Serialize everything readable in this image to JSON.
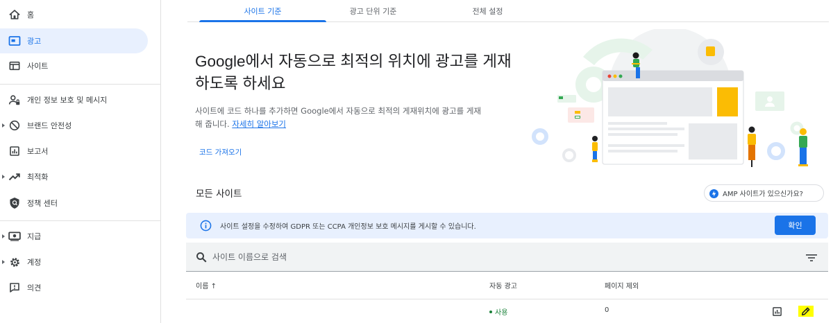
{
  "sidebar": {
    "items": [
      {
        "label": "홈",
        "icon": "home-icon"
      },
      {
        "label": "광고",
        "icon": "ad-icon",
        "active": true
      },
      {
        "label": "사이트",
        "icon": "sites-icon"
      },
      {
        "label": "개인 정보 보호 및 메시지",
        "icon": "privacy-icon"
      },
      {
        "label": "브랜드 안전성",
        "icon": "block-icon"
      },
      {
        "label": "보고서",
        "icon": "report-icon"
      },
      {
        "label": "최적화",
        "icon": "trending-icon"
      },
      {
        "label": "정책 센터",
        "icon": "policy-icon"
      },
      {
        "label": "지급",
        "icon": "payments-icon"
      },
      {
        "label": "계정",
        "icon": "settings-icon"
      },
      {
        "label": "의견",
        "icon": "feedback-icon"
      }
    ]
  },
  "tabs": [
    {
      "label": "사이트 기준",
      "active": true
    },
    {
      "label": "광고 단위 기준"
    },
    {
      "label": "전체 설정"
    }
  ],
  "hero": {
    "title_line1": "Google에서 자동으로 최적의 위치에 광고를 게재",
    "title_line2": "하도록 하세요",
    "desc_line1": "사이트에 코드 하나를 추가하면 Google에서 자동으로 최적의 게재위치에 광고를 게재",
    "desc_line2": "해 줍니다.",
    "learn_more": "자세히 알아보기",
    "import_code": "코드 가져오기"
  },
  "sites": {
    "title": "모든 사이트",
    "amp_chip": "AMP 사이트가 있으신가요?",
    "banner_text": "사이트 설정을 수정하여 GDPR 또는 CCPA 개인정보 보호 메시지를 게시할 수 있습니다.",
    "banner_button": "확인",
    "search_placeholder": "사이트 이름으로 검색",
    "columns": {
      "name": "이름 ↑",
      "auto_ads": "자동 광고",
      "excluded_pages": "페이지 제외"
    },
    "rows": [
      {
        "name": "",
        "auto_ads": "사용",
        "excluded_pages": "0"
      }
    ]
  },
  "colors": {
    "accent": "#1a73e8",
    "active_nav_bg": "#e8f0fe",
    "status_on": "#188038",
    "highlight": "#ffff00"
  }
}
